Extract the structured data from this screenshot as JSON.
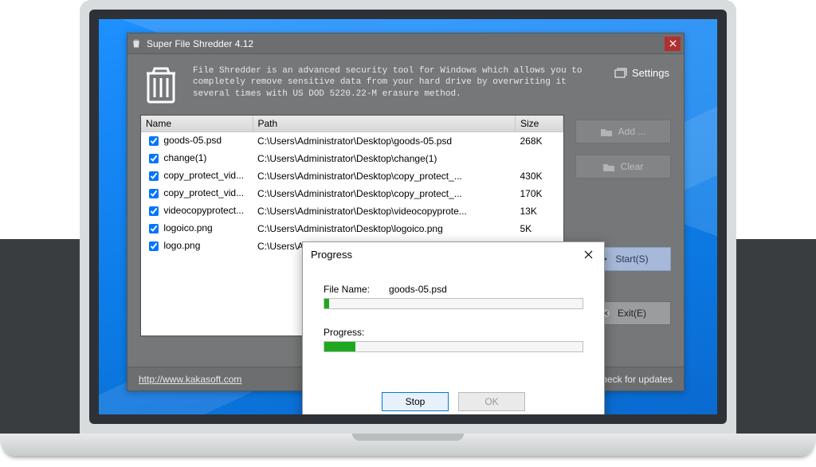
{
  "window": {
    "title": "Super File Shredder 4.12",
    "description": "File Shredder is an advanced security tool for Windows which allows you to completely remove sensitive data from your hard drive by overwriting it several times with US DOD 5220.22-M erasure method.",
    "settings_label": "Settings"
  },
  "columns": {
    "name": "Name",
    "path": "Path",
    "size": "Size"
  },
  "files": [
    {
      "checked": true,
      "name": "goods-05.psd",
      "path": "C:\\Users\\Administrator\\Desktop\\goods-05.psd",
      "size": "268K"
    },
    {
      "checked": true,
      "name": "change(1)",
      "path": "C:\\Users\\Administrator\\Desktop\\change(1)",
      "size": ""
    },
    {
      "checked": true,
      "name": "copy_protect_vid...",
      "path": "C:\\Users\\Administrator\\Desktop\\copy_protect_...",
      "size": "430K"
    },
    {
      "checked": true,
      "name": "copy_protect_vid...",
      "path": "C:\\Users\\Administrator\\Desktop\\copy_protect_...",
      "size": "170K"
    },
    {
      "checked": true,
      "name": "videocopyprotect...",
      "path": "C:\\Users\\Administrator\\Desktop\\videocopyprote...",
      "size": "13K"
    },
    {
      "checked": true,
      "name": "logoico.png",
      "path": "C:\\Users\\Administrator\\Desktop\\logoico.png",
      "size": "5K"
    },
    {
      "checked": true,
      "name": "logo.png",
      "path": "C:\\Users\\Ad",
      "size": ""
    }
  ],
  "buttons": {
    "add": "Add ...",
    "clear": "Clear",
    "start": "Start(S)",
    "exit": "Exit(E)"
  },
  "footer": {
    "url": "http://www.kakasoft.com",
    "updates": "Check for updates"
  },
  "dialog": {
    "title": "Progress",
    "file_label": "File Name:",
    "file_value": "goods-05.psd",
    "file_pct": 2,
    "progress_label": "Progress:",
    "progress_pct": 12,
    "stop": "Stop",
    "ok": "OK"
  }
}
